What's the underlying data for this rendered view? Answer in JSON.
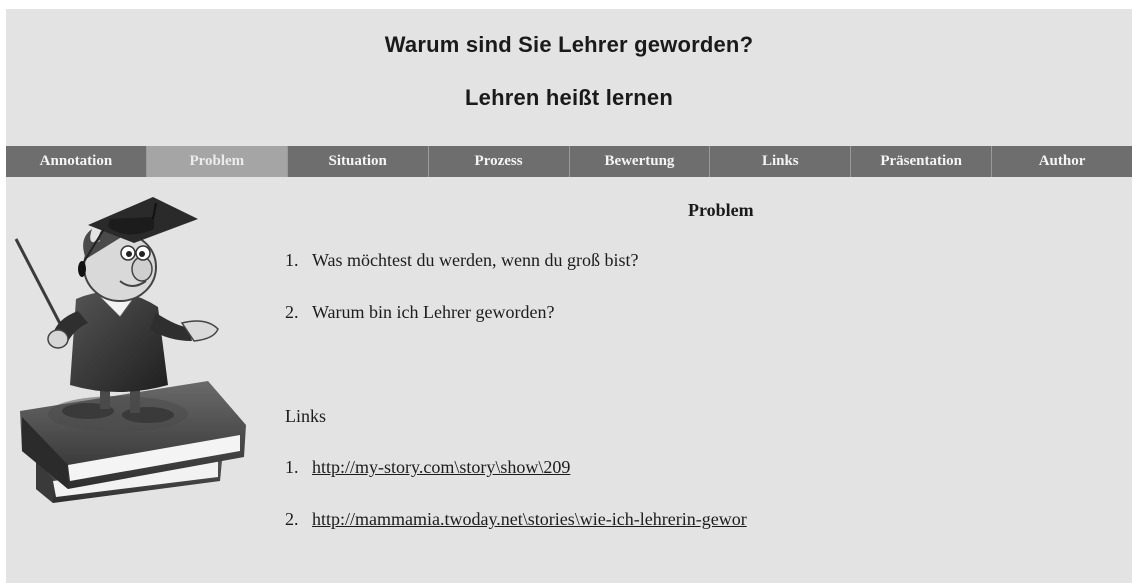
{
  "header": {
    "title": "Warum sind Sie Lehrer geworden?",
    "subtitle": "Lehren heißt lernen"
  },
  "nav": {
    "items": [
      "Annotation",
      "Problem",
      "Situation",
      "Prozess",
      "Bewertung",
      "Links",
      "Präsentation",
      "Author"
    ],
    "active": "Problem"
  },
  "main": {
    "heading": "Problem",
    "questions": [
      {
        "num": "1.",
        "text": "Was möchtest du werden, wenn du groß bist?"
      },
      {
        "num": "2.",
        "text": "Warum bin ich Lehrer geworden?"
      }
    ],
    "links_label": "Links",
    "links": [
      {
        "num": "1.",
        "text": "http://my-story.com\\story\\show\\209"
      },
      {
        "num": "2.",
        "text": "http://mammamia.twoday.net\\stories\\wie-ich-lehrerin-gewor"
      }
    ]
  },
  "colors": {
    "page_bg": "#e3e3e3",
    "nav_bg": "#6e6e6e",
    "nav_active_bg": "#a5a5a5"
  },
  "illustration": {
    "icon": "teacher-on-books-icon"
  }
}
